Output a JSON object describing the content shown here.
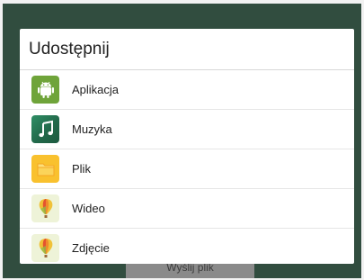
{
  "dialog": {
    "title": "Udostępnij",
    "items": [
      {
        "label": "Aplikacja",
        "icon": "android-icon",
        "color": "#6a9a3a"
      },
      {
        "label": "Muzyka",
        "icon": "music-note-icon",
        "color": "#2a7d5a"
      },
      {
        "label": "Plik",
        "icon": "folder-icon",
        "color": "#f7c32b"
      },
      {
        "label": "Wideo",
        "icon": "balloon-icon",
        "color": "#f0c43c"
      },
      {
        "label": "Zdjęcie",
        "icon": "balloon-icon",
        "color": "#f0c43c"
      }
    ]
  },
  "background": {
    "send_button_label": "Wyślij plik"
  }
}
